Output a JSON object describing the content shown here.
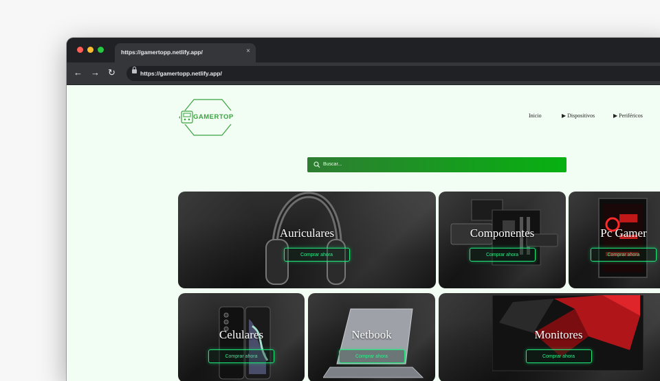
{
  "browser": {
    "tab_title": "https://gamertopp.netlify.app/",
    "tab_close": "×",
    "url": "https://gamertopp.netlify.app/",
    "back_icon": "←",
    "forward_icon": "→",
    "reload_icon": "↻"
  },
  "site": {
    "logo_text": "GAMERTOP",
    "nav": [
      {
        "label": "Inicio"
      },
      {
        "label": "▶ Dispositivos"
      },
      {
        "label": "▶ Periféricos"
      }
    ],
    "search_placeholder": "Buscar..."
  },
  "cards": [
    {
      "title": "Auriculares",
      "button": "Comprar ahora"
    },
    {
      "title": "Componentes",
      "button": "Comprar ahora"
    },
    {
      "title": "Pc Gamer",
      "button": "Comprar ahora"
    },
    {
      "title": "Celulares",
      "button": "Comprar ahora"
    },
    {
      "title": "Netbook",
      "button": "Comprar ahora"
    },
    {
      "title": "Monitores",
      "button": "Comprar ahora"
    }
  ],
  "colors": {
    "page_bg": "#f2fdf3",
    "accent_green": "#07b111",
    "button_green": "#1ee87c",
    "logo_green": "#3aa43f"
  }
}
